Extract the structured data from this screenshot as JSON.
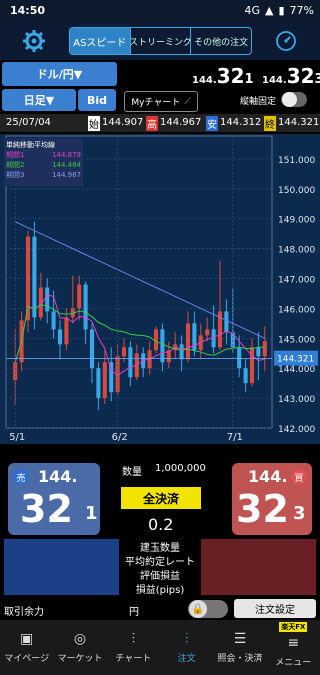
{
  "status": {
    "time": "14:50",
    "network": "4G",
    "battery": "77%"
  },
  "header": {
    "tabs": [
      "ASスピード",
      "ストリーミング",
      "その他の注文"
    ]
  },
  "pair": {
    "label": "ドル/円▼",
    "bid_small": "144.",
    "bid_big": "32",
    "bid_frac": "1",
    "ask_small": "144.",
    "ask_big": "32",
    "ask_frac": "3"
  },
  "controls": {
    "period": "日足▼",
    "side": "Bid",
    "mychart": "Myチャート",
    "axis_fix": "縦軸固定"
  },
  "ohlc": {
    "date": "25/07/04",
    "open_label": "始",
    "open": "144.907",
    "high_label": "高",
    "high": "144.967",
    "low_label": "安",
    "low": "144.312",
    "close_label": "終",
    "close": "144.321"
  },
  "chart_data": {
    "type": "candlestick",
    "legend_title": "単純移動平均線",
    "legend": [
      {
        "name": "期間1",
        "value": "144.879",
        "color": "#e040c8"
      },
      {
        "name": "期間2",
        "value": "144.484",
        "color": "#3cc84a"
      },
      {
        "name": "期間3",
        "value": "144.987",
        "color": "#6d7fe8"
      }
    ],
    "y_ticks": [
      "151.000",
      "150.000",
      "149.000",
      "148.000",
      "147.000",
      "146.000",
      "145.000",
      "144.000",
      "143.000",
      "142.000"
    ],
    "ylim": [
      142,
      151.5
    ],
    "x_ticks": [
      "5/1",
      "6/2",
      "7/1"
    ],
    "current_price": "144.321",
    "candles": [
      [
        143.6,
        144.2,
        142.8,
        145.3
      ],
      [
        144.2,
        145.6,
        143.9,
        145.9
      ],
      [
        145.6,
        148.4,
        145.2,
        148.6
      ],
      [
        148.4,
        145.7,
        145.3,
        148.9
      ],
      [
        145.7,
        146.7,
        145.6,
        147.2
      ],
      [
        146.7,
        145.9,
        145.5,
        147.0
      ],
      [
        145.9,
        145.3,
        145.0,
        146.6
      ],
      [
        145.3,
        144.8,
        144.3,
        145.6
      ],
      [
        144.8,
        145.7,
        144.6,
        146.0
      ],
      [
        145.7,
        146.0,
        145.5,
        147.1
      ],
      [
        146.0,
        146.8,
        145.6,
        147.1
      ],
      [
        146.8,
        145.3,
        144.8,
        146.9
      ],
      [
        145.3,
        144.0,
        143.5,
        145.5
      ],
      [
        144.0,
        143.0,
        142.6,
        144.2
      ],
      [
        143.0,
        144.2,
        142.8,
        144.6
      ],
      [
        144.2,
        143.2,
        142.9,
        144.7
      ],
      [
        143.2,
        144.4,
        143.1,
        144.8
      ],
      [
        144.4,
        144.7,
        144.2,
        145.0
      ],
      [
        144.7,
        143.7,
        143.4,
        144.9
      ],
      [
        143.7,
        144.5,
        143.6,
        144.8
      ],
      [
        144.5,
        144.0,
        143.7,
        144.7
      ],
      [
        144.0,
        144.6,
        143.8,
        144.9
      ],
      [
        144.6,
        145.3,
        144.5,
        145.4
      ],
      [
        145.3,
        144.2,
        143.9,
        145.5
      ],
      [
        144.2,
        144.6,
        144.0,
        144.9
      ],
      [
        144.6,
        144.8,
        144.3,
        145.2
      ],
      [
        144.8,
        144.3,
        143.9,
        145.1
      ],
      [
        144.3,
        145.5,
        144.2,
        145.9
      ],
      [
        145.5,
        144.6,
        144.4,
        145.9
      ],
      [
        144.6,
        145.1,
        144.3,
        145.5
      ],
      [
        145.1,
        145.3,
        144.9,
        145.7
      ],
      [
        145.3,
        144.7,
        144.5,
        146.1
      ],
      [
        144.7,
        145.9,
        144.6,
        147.6
      ],
      [
        145.9,
        145.2,
        144.8,
        146.3
      ],
      [
        145.2,
        144.7,
        144.5,
        146.7
      ],
      [
        144.7,
        144.0,
        143.7,
        145.1
      ],
      [
        144.0,
        143.5,
        143.2,
        144.3
      ],
      [
        143.5,
        144.7,
        143.4,
        145.0
      ],
      [
        144.7,
        144.4,
        143.6,
        145.2
      ],
      [
        144.4,
        144.9,
        143.9,
        145.4
      ]
    ]
  },
  "trade": {
    "qty_label": "数量",
    "qty_value": "1,000,000",
    "close_all": "全決済",
    "spread": "0.2",
    "sell_label": "売",
    "buy_label": "買",
    "rows": [
      "建玉数量",
      "平均約定レート",
      "評価損益",
      "損益(pips)"
    ]
  },
  "footer": {
    "margin_label": "取引余力",
    "currency": "円",
    "order_settings": "注文設定",
    "rakuten": "楽天FX"
  },
  "nav": [
    "マイページ",
    "マーケット",
    "チャート",
    "注文",
    "照会・決済",
    "メニュー"
  ]
}
